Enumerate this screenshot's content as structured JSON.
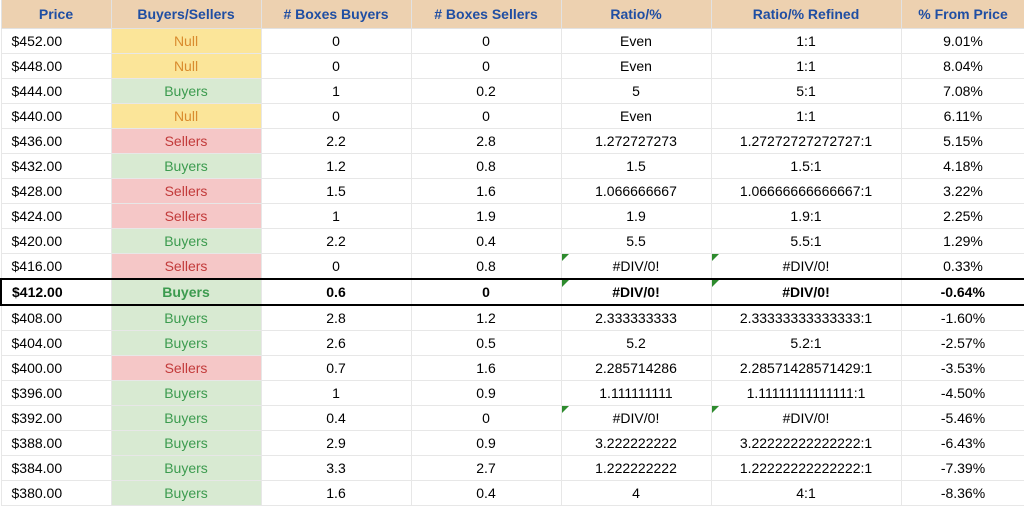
{
  "headers": [
    "Price",
    "Buyers/Sellers",
    "# Boxes Buyers",
    "# Boxes Sellers",
    "Ratio/%",
    "Ratio/% Refined",
    "% From Price"
  ],
  "rows": [
    {
      "price": "$452.00",
      "bs": "Null",
      "boxBuy": "0",
      "boxSell": "0",
      "ratio": "Even",
      "refined": "1:1",
      "pct": "9.01%",
      "state": "null",
      "hl": false,
      "err5": false,
      "err6": false
    },
    {
      "price": "$448.00",
      "bs": "Null",
      "boxBuy": "0",
      "boxSell": "0",
      "ratio": "Even",
      "refined": "1:1",
      "pct": "8.04%",
      "state": "null",
      "hl": false,
      "err5": false,
      "err6": false
    },
    {
      "price": "$444.00",
      "bs": "Buyers",
      "boxBuy": "1",
      "boxSell": "0.2",
      "ratio": "5",
      "refined": "5:1",
      "pct": "7.08%",
      "state": "buyers",
      "hl": false,
      "err5": false,
      "err6": false
    },
    {
      "price": "$440.00",
      "bs": "Null",
      "boxBuy": "0",
      "boxSell": "0",
      "ratio": "Even",
      "refined": "1:1",
      "pct": "6.11%",
      "state": "null",
      "hl": false,
      "err5": false,
      "err6": false
    },
    {
      "price": "$436.00",
      "bs": "Sellers",
      "boxBuy": "2.2",
      "boxSell": "2.8",
      "ratio": "1.272727273",
      "refined": "1.27272727272727:1",
      "pct": "5.15%",
      "state": "sellers",
      "hl": false,
      "err5": false,
      "err6": false
    },
    {
      "price": "$432.00",
      "bs": "Buyers",
      "boxBuy": "1.2",
      "boxSell": "0.8",
      "ratio": "1.5",
      "refined": "1.5:1",
      "pct": "4.18%",
      "state": "buyers",
      "hl": false,
      "err5": false,
      "err6": false
    },
    {
      "price": "$428.00",
      "bs": "Sellers",
      "boxBuy": "1.5",
      "boxSell": "1.6",
      "ratio": "1.066666667",
      "refined": "1.06666666666667:1",
      "pct": "3.22%",
      "state": "sellers",
      "hl": false,
      "err5": false,
      "err6": false
    },
    {
      "price": "$424.00",
      "bs": "Sellers",
      "boxBuy": "1",
      "boxSell": "1.9",
      "ratio": "1.9",
      "refined": "1.9:1",
      "pct": "2.25%",
      "state": "sellers",
      "hl": false,
      "err5": false,
      "err6": false
    },
    {
      "price": "$420.00",
      "bs": "Buyers",
      "boxBuy": "2.2",
      "boxSell": "0.4",
      "ratio": "5.5",
      "refined": "5.5:1",
      "pct": "1.29%",
      "state": "buyers",
      "hl": false,
      "err5": false,
      "err6": false
    },
    {
      "price": "$416.00",
      "bs": "Sellers",
      "boxBuy": "0",
      "boxSell": "0.8",
      "ratio": "#DIV/0!",
      "refined": "#DIV/0!",
      "pct": "0.33%",
      "state": "sellers",
      "hl": false,
      "err5": true,
      "err6": true
    },
    {
      "price": "$412.00",
      "bs": "Buyers",
      "boxBuy": "0.6",
      "boxSell": "0",
      "ratio": "#DIV/0!",
      "refined": "#DIV/0!",
      "pct": "-0.64%",
      "state": "buyers",
      "hl": true,
      "err5": true,
      "err6": true
    },
    {
      "price": "$408.00",
      "bs": "Buyers",
      "boxBuy": "2.8",
      "boxSell": "1.2",
      "ratio": "2.333333333",
      "refined": "2.33333333333333:1",
      "pct": "-1.60%",
      "state": "buyers",
      "hl": false,
      "err5": false,
      "err6": false
    },
    {
      "price": "$404.00",
      "bs": "Buyers",
      "boxBuy": "2.6",
      "boxSell": "0.5",
      "ratio": "5.2",
      "refined": "5.2:1",
      "pct": "-2.57%",
      "state": "buyers",
      "hl": false,
      "err5": false,
      "err6": false
    },
    {
      "price": "$400.00",
      "bs": "Sellers",
      "boxBuy": "0.7",
      "boxSell": "1.6",
      "ratio": "2.285714286",
      "refined": "2.28571428571429:1",
      "pct": "-3.53%",
      "state": "sellers",
      "hl": false,
      "err5": false,
      "err6": false
    },
    {
      "price": "$396.00",
      "bs": "Buyers",
      "boxBuy": "1",
      "boxSell": "0.9",
      "ratio": "1.111111111",
      "refined": "1.11111111111111:1",
      "pct": "-4.50%",
      "state": "buyers",
      "hl": false,
      "err5": false,
      "err6": false
    },
    {
      "price": "$392.00",
      "bs": "Buyers",
      "boxBuy": "0.4",
      "boxSell": "0",
      "ratio": "#DIV/0!",
      "refined": "#DIV/0!",
      "pct": "-5.46%",
      "state": "buyers",
      "hl": false,
      "err5": true,
      "err6": true
    },
    {
      "price": "$388.00",
      "bs": "Buyers",
      "boxBuy": "2.9",
      "boxSell": "0.9",
      "ratio": "3.222222222",
      "refined": "3.22222222222222:1",
      "pct": "-6.43%",
      "state": "buyers",
      "hl": false,
      "err5": false,
      "err6": false
    },
    {
      "price": "$384.00",
      "bs": "Buyers",
      "boxBuy": "3.3",
      "boxSell": "2.7",
      "ratio": "1.222222222",
      "refined": "1.22222222222222:1",
      "pct": "-7.39%",
      "state": "buyers",
      "hl": false,
      "err5": false,
      "err6": false
    },
    {
      "price": "$380.00",
      "bs": "Buyers",
      "boxBuy": "1.6",
      "boxSell": "0.4",
      "ratio": "4",
      "refined": "4:1",
      "pct": "-8.36%",
      "state": "buyers",
      "hl": false,
      "err5": false,
      "err6": false
    }
  ]
}
